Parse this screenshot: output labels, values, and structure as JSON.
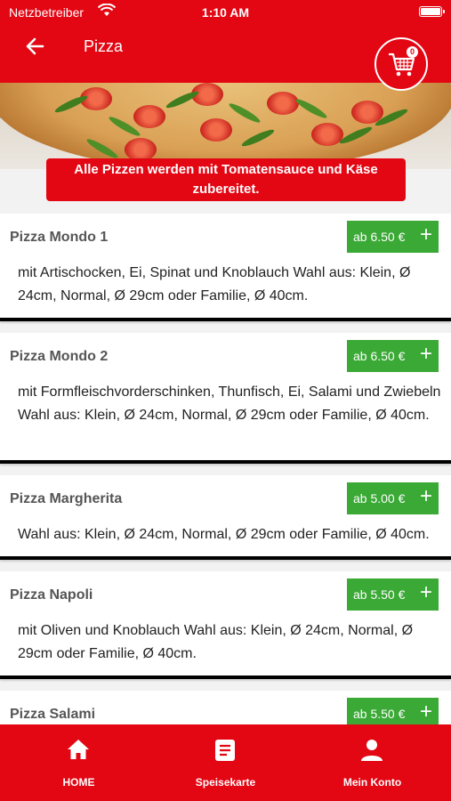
{
  "status_bar": {
    "carrier": "Netzbetreiber",
    "time": "1:10 AM"
  },
  "header": {
    "title": "Pizza",
    "cart_count": "0"
  },
  "notice": "Alle Pizzen werden mit Tomatensauce und Käse zubereitet.",
  "items": [
    {
      "name": "Pizza Mondo 1",
      "price": "ab 6.50 €",
      "description": "mit Artischocken, Ei, Spinat und Knoblauch Wahl aus: Klein, Ø 24cm, Normal, Ø 29cm oder Familie, Ø 40cm."
    },
    {
      "name": "Pizza Mondo 2",
      "price": "ab 6.50 €",
      "description": "mit Formfleischvorderschinken, Thunfisch, Ei, Salami und Zwiebeln Wahl aus: Klein, Ø 24cm, Normal, Ø 29cm oder Familie, Ø 40cm."
    },
    {
      "name": "Pizza Margherita",
      "price": "ab 5.00 €",
      "description": "Wahl aus: Klein, Ø 24cm, Normal, Ø 29cm oder Familie, Ø 40cm."
    },
    {
      "name": "Pizza Napoli",
      "price": "ab 5.50 €",
      "description": "mit Oliven und Knoblauch Wahl aus: Klein, Ø 24cm, Normal, Ø 29cm oder Familie, Ø 40cm."
    },
    {
      "name": "Pizza Salami",
      "price": "ab 5.50 €",
      "description": ""
    }
  ],
  "add_symbol": "+",
  "nav": [
    {
      "label": "HOME",
      "icon": "home-icon"
    },
    {
      "label": "Speisekarte",
      "icon": "menu-icon"
    },
    {
      "label": "Mein Konto",
      "icon": "user-icon"
    }
  ],
  "colors": {
    "brand": "#e30613",
    "price_button": "#3aa935"
  }
}
